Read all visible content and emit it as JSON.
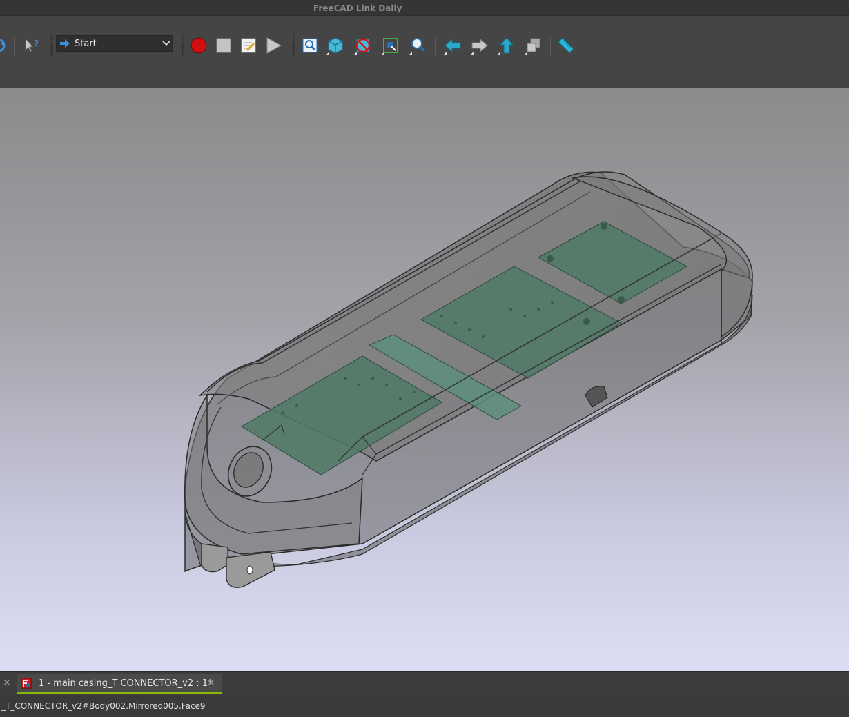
{
  "window": {
    "title": "FreeCAD Link Daily"
  },
  "toolbar": {
    "workbench_selector": {
      "value": "Start"
    },
    "buttons": [
      {
        "name": "refresh",
        "icon": "refresh-icon"
      },
      {
        "name": "whats-this",
        "icon": "whats-this-icon"
      },
      {
        "name": "macro-record",
        "icon": "record-icon"
      },
      {
        "name": "macro-stop",
        "icon": "stop-icon"
      },
      {
        "name": "macro-edit",
        "icon": "macro-edit-icon"
      },
      {
        "name": "macro-run",
        "icon": "play-icon"
      },
      {
        "name": "fit-all",
        "icon": "fit-all-icon"
      },
      {
        "name": "view-cube",
        "icon": "isometric-icon"
      },
      {
        "name": "draw-style",
        "icon": "draw-style-icon"
      },
      {
        "name": "bounding-box",
        "icon": "bounding-box-icon"
      },
      {
        "name": "fit-selection",
        "icon": "fit-selection-icon"
      },
      {
        "name": "back",
        "icon": "arrow-left-icon"
      },
      {
        "name": "forward",
        "icon": "arrow-right-icon"
      },
      {
        "name": "up",
        "icon": "arrow-up-icon"
      },
      {
        "name": "link-nav",
        "icon": "link-nav-icon"
      },
      {
        "name": "measure",
        "icon": "ruler-icon"
      }
    ]
  },
  "tabs": [
    {
      "label": "1 - main casing_T CONNECTOR_v2 : 1*",
      "active": true
    }
  ],
  "status": {
    "text": "_T_CONNECTOR_v2#Body002.Mirrored005.Face9"
  },
  "colors": {
    "accent": "#8ab800",
    "viewport_top": "#8b8b8c",
    "viewport_bottom": "#ddddf3",
    "pcb": "#4f7a66"
  }
}
